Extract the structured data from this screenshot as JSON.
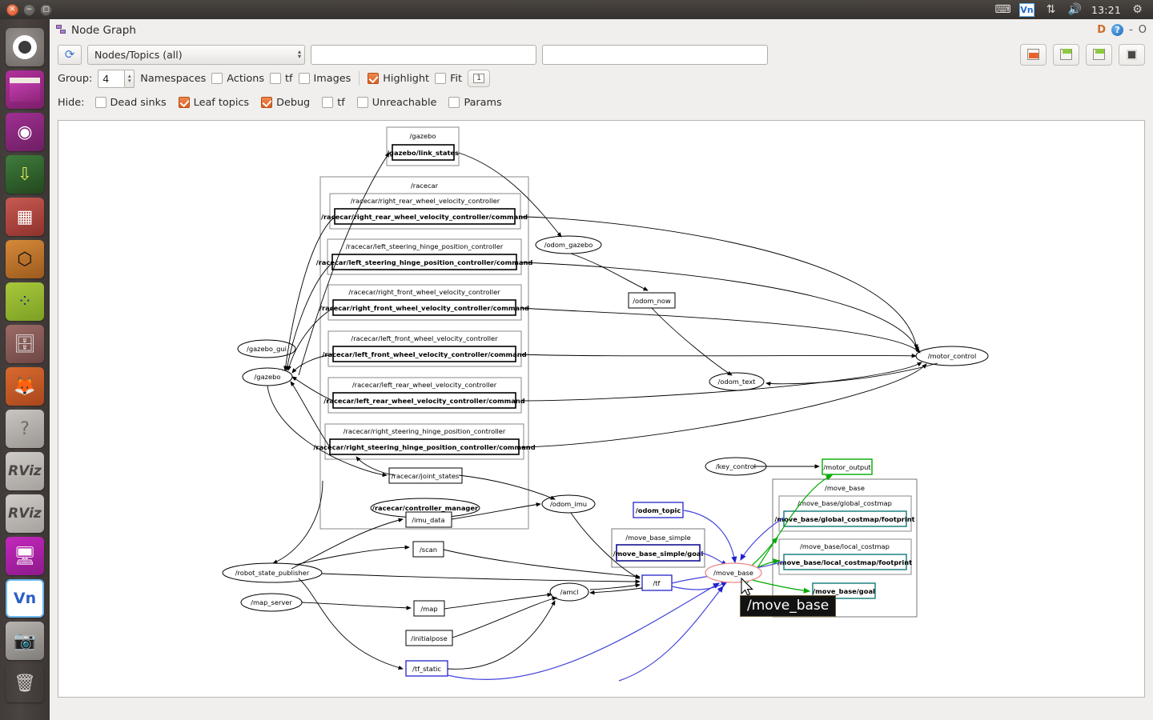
{
  "desktop": {
    "window_controls": [
      "close",
      "minimize",
      "maximize"
    ],
    "tray": {
      "keyboard_icon": "keyboard-icon",
      "vnc_label": "Vn",
      "network_icon": "network-updown-icon",
      "volume_icon": "volume-icon",
      "clock": "13:21",
      "gear_icon": "gear-icon"
    },
    "launcher": [
      {
        "name": "ubuntu-dash",
        "label": "Ubuntu Dash"
      },
      {
        "name": "files",
        "label": "Files"
      },
      {
        "name": "software-center",
        "label": "Software Center"
      },
      {
        "name": "terminal-download",
        "label": "Terminal"
      },
      {
        "name": "red-app",
        "label": "Red App"
      },
      {
        "name": "orange-box-app",
        "label": "Box App"
      },
      {
        "name": "green-graph-app",
        "label": "Graph App"
      },
      {
        "name": "file-cabinet",
        "label": "File Cabinet"
      },
      {
        "name": "firefox",
        "label": "Firefox"
      },
      {
        "name": "help",
        "label": "Help"
      },
      {
        "name": "rviz-1",
        "label": "RViz"
      },
      {
        "name": "rviz-2",
        "label": "RViz"
      },
      {
        "name": "remote-desktop",
        "label": "Remote Desktop"
      },
      {
        "name": "vnc-viewer",
        "label": "VNC"
      },
      {
        "name": "camera",
        "label": "Camera"
      },
      {
        "name": "trash",
        "label": "Trash"
      }
    ]
  },
  "window": {
    "title": "Node Graph",
    "right_marks": {
      "dock": "D",
      "help": "?",
      "minimize": "-",
      "maximize": "O"
    }
  },
  "toolbar": {
    "refresh_icon": "refresh-icon",
    "filter_select_value": "Nodes/Topics (all)",
    "topic_filter_value": "",
    "topic_filter_placeholder": "",
    "node_filter_value": "",
    "node_filter_placeholder": "",
    "buttons": [
      {
        "name": "load-dot-button",
        "icon": "folder-icon"
      },
      {
        "name": "save-dot-button",
        "icon": "save-dot-icon"
      },
      {
        "name": "save-image-button",
        "icon": "save-image-icon"
      },
      {
        "name": "fit-in-view-button",
        "icon": "fit-square-icon"
      }
    ],
    "group_label": "Group:",
    "group_value": "4",
    "namespaces_label": "Namespaces",
    "actions_label": "Actions",
    "tf_label": "tf",
    "images_label": "Images",
    "highlight_label": "Highlight",
    "fit_label": "Fit",
    "depth_button_value": "1",
    "checks": {
      "namespaces": false,
      "actions": false,
      "tf": false,
      "images": false,
      "highlight": true,
      "fit": false
    },
    "hide_label": "Hide:",
    "hide_items": [
      {
        "label": "Dead sinks",
        "checked": false,
        "name": "hide-dead-sinks"
      },
      {
        "label": "Leaf topics",
        "checked": true,
        "name": "hide-leaf-topics"
      },
      {
        "label": "Debug",
        "checked": true,
        "name": "hide-debug"
      },
      {
        "label": "tf",
        "checked": false,
        "name": "hide-tf"
      },
      {
        "label": "Unreachable",
        "checked": false,
        "name": "hide-unreachable"
      },
      {
        "label": "Params",
        "checked": false,
        "name": "hide-params"
      }
    ]
  },
  "tooltip": {
    "text": "/move_base"
  },
  "colors": {
    "highlight_node_red": "#ee2222",
    "highlight_green": "#00aa00",
    "highlight_blue": "#2222cc",
    "teal": "#117777",
    "navy": "#222299",
    "accent_orange": "#e8622a"
  },
  "graph": {
    "clusters": [
      {
        "name": "cluster-gazebo",
        "label": "/gazebo"
      },
      {
        "name": "cluster-racecar",
        "label": "/racecar"
      },
      {
        "name": "cluster-rr-wheel",
        "label": "/racecar/right_rear_wheel_velocity_controller"
      },
      {
        "name": "cluster-ls-hinge",
        "label": "/racecar/left_steering_hinge_position_controller"
      },
      {
        "name": "cluster-rf-wheel",
        "label": "/racecar/right_front_wheel_velocity_controller"
      },
      {
        "name": "cluster-lf-wheel",
        "label": "/racecar/left_front_wheel_velocity_controller"
      },
      {
        "name": "cluster-lr-wheel",
        "label": "/racecar/left_rear_wheel_velocity_controller"
      },
      {
        "name": "cluster-rs-hinge",
        "label": "/racecar/right_steering_hinge_position_controller"
      },
      {
        "name": "cluster-move-base",
        "label": "/move_base"
      },
      {
        "name": "cluster-global-costmap",
        "label": "/move_base/global_costmap"
      },
      {
        "name": "cluster-local-costmap",
        "label": "/move_base/local_costmap"
      },
      {
        "name": "cluster-move-base-simple",
        "label": "/move_base_simple"
      }
    ],
    "topic_boxes": [
      {
        "name": "topic-gazebo-link-states",
        "label": "/gazebo/link_states",
        "style": "bold"
      },
      {
        "name": "topic-rr-command",
        "label": "/racecar/right_rear_wheel_velocity_controller/command",
        "style": "bold"
      },
      {
        "name": "topic-ls-command",
        "label": "/racecar/left_steering_hinge_position_controller/command",
        "style": "bold"
      },
      {
        "name": "topic-rf-command",
        "label": "/racecar/right_front_wheel_velocity_controller/command",
        "style": "bold"
      },
      {
        "name": "topic-lf-command",
        "label": "/racecar/left_front_wheel_velocity_controller/command",
        "style": "bold"
      },
      {
        "name": "topic-lr-command",
        "label": "/racecar/left_rear_wheel_velocity_controller/command",
        "style": "bold"
      },
      {
        "name": "topic-rs-command",
        "label": "/racecar/right_steering_hinge_position_controller/command",
        "style": "bold"
      },
      {
        "name": "topic-racecar-joint-states",
        "label": "/racecar/joint_states",
        "style": "plain"
      },
      {
        "name": "topic-odom-now",
        "label": "/odom_now",
        "style": "plain"
      },
      {
        "name": "topic-motor-output",
        "label": "/motor_output",
        "style": "green"
      },
      {
        "name": "topic-global-costmap-footprint",
        "label": "/move_base/global_costmap/footprint",
        "style": "teal"
      },
      {
        "name": "topic-local-costmap-footprint",
        "label": "/move_base/local_costmap/footprint",
        "style": "teal"
      },
      {
        "name": "topic-move-base-goal",
        "label": "/move_base/goal",
        "style": "teal"
      },
      {
        "name": "topic-odom-topic",
        "label": "/odom_topic",
        "style": "navy"
      },
      {
        "name": "topic-move-base-simple-goal",
        "label": "/move_base_simple/goal",
        "style": "navy-bold"
      },
      {
        "name": "topic-tf",
        "label": "/tf",
        "style": "navy"
      },
      {
        "name": "topic-tf-static",
        "label": "/tf_static",
        "style": "navy"
      },
      {
        "name": "topic-imu-data",
        "label": "/imu_data",
        "style": "plain"
      },
      {
        "name": "topic-scan",
        "label": "/scan",
        "style": "plain"
      },
      {
        "name": "topic-map",
        "label": "/map",
        "style": "plain"
      },
      {
        "name": "topic-initialpose",
        "label": "/initialpose",
        "style": "plain"
      }
    ],
    "node_ovals": [
      {
        "name": "node-gazebo-gui",
        "label": "/gazebo_gui"
      },
      {
        "name": "node-gazebo",
        "label": "/gazebo"
      },
      {
        "name": "node-odom-gazebo",
        "label": "/odom_gazebo"
      },
      {
        "name": "node-odom-text",
        "label": "/odom_text"
      },
      {
        "name": "node-motor-control",
        "label": "/motor_control"
      },
      {
        "name": "node-key-control",
        "label": "/key_control"
      },
      {
        "name": "node-racecar-controller-manager",
        "label": "/racecar/controller_manager"
      },
      {
        "name": "node-odom-imu",
        "label": "/odom_imu"
      },
      {
        "name": "node-amcl",
        "label": "/amcl"
      },
      {
        "name": "node-robot-state-publisher",
        "label": "/robot_state_publisher"
      },
      {
        "name": "node-map-server",
        "label": "/map_server"
      },
      {
        "name": "node-move-base",
        "label": "/move_base",
        "highlighted": true
      }
    ]
  }
}
